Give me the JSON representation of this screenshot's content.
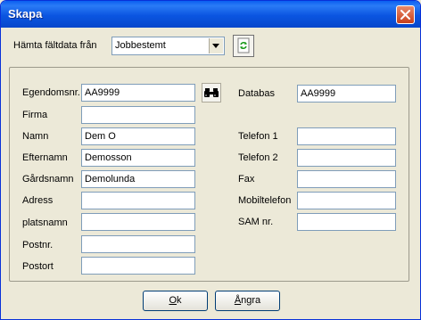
{
  "window": {
    "title": "Skapa"
  },
  "source": {
    "label": "Hämta fältdata från",
    "selected": "Jobbestemt"
  },
  "left_fields": [
    {
      "label": "Egendomsnr.",
      "value": "AA9999"
    },
    {
      "label": "Firma",
      "value": ""
    },
    {
      "label": "Namn",
      "value": "Dem O"
    },
    {
      "label": "Efternamn",
      "value": "Demosson"
    },
    {
      "label": "Gårdsnamn",
      "value": "Demolunda"
    },
    {
      "label": "Adress",
      "value": ""
    },
    {
      "label": "platsnamn",
      "value": ""
    },
    {
      "label": "Postnr.",
      "value": ""
    },
    {
      "label": "Postort",
      "value": ""
    }
  ],
  "right_fields": [
    {
      "label": "Databas",
      "value": "AA9999"
    },
    {
      "label": "Telefon 1",
      "value": ""
    },
    {
      "label": "Telefon 2",
      "value": ""
    },
    {
      "label": "Fax",
      "value": ""
    },
    {
      "label": "Mobiltelefon",
      "value": ""
    },
    {
      "label": "SAM nr.",
      "value": ""
    }
  ],
  "buttons": {
    "ok_mnemonic": "O",
    "ok_rest": "k",
    "cancel_mnemonic": "Å",
    "cancel_rest": "ngra"
  },
  "icons": {
    "close": "close-icon",
    "dropdown": "chevron-down-icon",
    "refresh": "refresh-icon",
    "search": "binoculars-icon"
  }
}
